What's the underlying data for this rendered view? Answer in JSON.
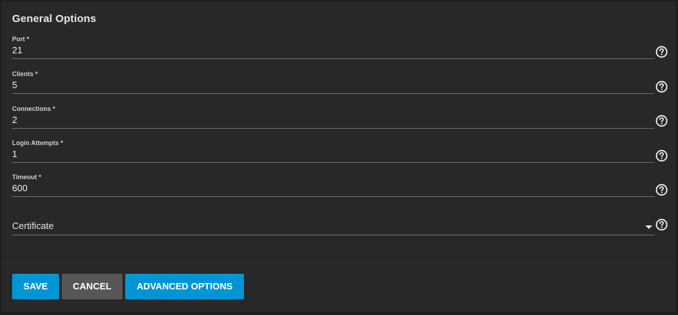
{
  "section": {
    "title": "General Options"
  },
  "fields": [
    {
      "label": "Port *",
      "value": "21",
      "help_icon": "help-circle-icon"
    },
    {
      "label": "Clients *",
      "value": "5",
      "help_icon": "help-circle-icon"
    },
    {
      "label": "Connections *",
      "value": "2",
      "help_icon": "help-circle-icon"
    },
    {
      "label": "Login Attempts *",
      "value": "1",
      "help_icon": "help-circle-icon"
    },
    {
      "label": "Timeout *",
      "value": "600",
      "help_icon": "help-circle-icon"
    }
  ],
  "certificate": {
    "label": "Certificate",
    "selected": "",
    "icon": "dropdown-arrow-icon"
  },
  "buttons": {
    "save": "SAVE",
    "cancel": "CANCEL",
    "advanced": "ADVANCED OPTIONS"
  },
  "colors": {
    "primary": "#0095d5",
    "cancel": "#575757",
    "card_background": "#282828",
    "page_background": "#1e1e1e"
  }
}
